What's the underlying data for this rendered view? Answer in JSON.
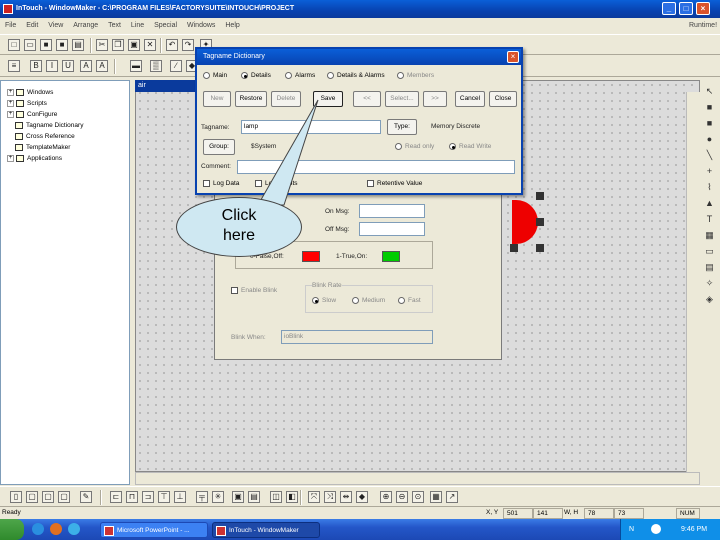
{
  "window": {
    "title": "InTouch - WindowMaker - C:\\PROGRAM FILES\\FACTORYSUITE\\INTOUCH\\PROJECT",
    "right_label": "Runtime!"
  },
  "menu": [
    "File",
    "Edit",
    "View",
    "Arrange",
    "Text",
    "Line",
    "Special",
    "Windows",
    "Help"
  ],
  "tree": {
    "items": [
      "Windows",
      "Scripts",
      "ConFigure",
      "Tagname Dictionary",
      "Cross Reference",
      "TemplateMaker",
      "Applications"
    ]
  },
  "canvas": {
    "window_label": "air"
  },
  "back_dialog": {
    "on_msg_label": "On Msg:",
    "off_msg_label": "Off Msg:",
    "false_color_label": "0-False,Off:",
    "true_color_label": "1-True,On:",
    "false_color": "#ff0000",
    "true_color": "#00cc00",
    "enable_blink_label": "Enable Blink",
    "blink_rate_label": "Blink Rate",
    "blink_options": [
      "Slow",
      "Medium",
      "Fast"
    ],
    "blink_when_label": "Blink When:",
    "blink_when_value": "ioBlink"
  },
  "dialog": {
    "title": "Tagname Dictionary",
    "close_glyph": "×",
    "view_options": [
      "Main",
      "Details",
      "Alarms",
      "Details & Alarms",
      "Members"
    ],
    "selected_view": "Details",
    "buttons": [
      "New",
      "Restore",
      "Delete",
      "Save",
      "<<",
      "Select...",
      ">>",
      "Cancel",
      "Close"
    ],
    "tagname_label": "Tagname:",
    "tagname_value": "lamp",
    "type_button": "Type:",
    "type_value": "Memory Discrete",
    "group_button": "Group:",
    "group_value": "$System",
    "access_options": [
      "Read only",
      "Read Write"
    ],
    "selected_access": "Read Write",
    "comment_label": "Comment:",
    "comment_value": "",
    "log_data_label": "Log Data",
    "log_events_label": "Log Events",
    "retentive_label": "Retentive Value"
  },
  "callout": {
    "line1": "Click",
    "line2": "here"
  },
  "status": {
    "ready": "Ready",
    "xy_label": "X, Y",
    "x_value": "501",
    "y_value": "141",
    "wh_label": "W, H",
    "w_value": "78",
    "h_value": "73",
    "num_indicator": "NUM"
  },
  "taskbar": {
    "tasks": [
      "Microsoft PowerPoint - ...",
      "InTouch - WindowMaker"
    ],
    "tray_lang": "N",
    "tray_time": "9:46 PM"
  }
}
